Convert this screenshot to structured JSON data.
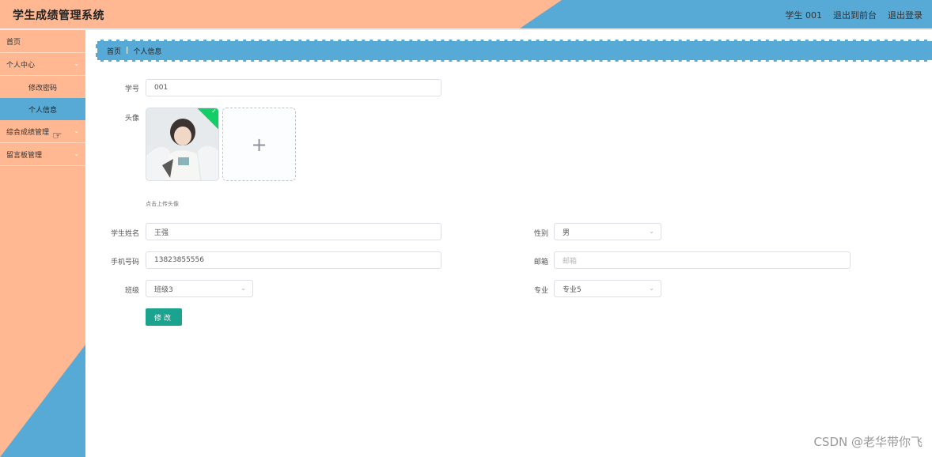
{
  "header": {
    "title": "学生成绩管理系统",
    "user": "学生 001",
    "front_link": "退出到前台",
    "logout_link": "退出登录"
  },
  "sidebar": {
    "items": [
      {
        "label": "首页"
      },
      {
        "label": "个人中心",
        "children": [
          {
            "label": "修改密码"
          },
          {
            "label": "个人信息",
            "active": true
          }
        ]
      },
      {
        "label": "综合成绩管理"
      },
      {
        "label": "留言板管理"
      }
    ]
  },
  "breadcrumb": {
    "home": "首页",
    "separator": "|",
    "current": "个人信息"
  },
  "form": {
    "student_id_label": "学号",
    "student_id_value": "001",
    "avatar_label": "头像",
    "upload_hint": "点击上传头像",
    "name_label": "学生姓名",
    "name_value": "王强",
    "gender_label": "性别",
    "gender_value": "男",
    "phone_label": "手机号码",
    "phone_value": "13823855556",
    "email_label": "邮箱",
    "email_placeholder": "邮箱",
    "class_label": "班级",
    "class_value": "班级3",
    "major_label": "专业",
    "major_value": "专业5",
    "submit_label": "修改"
  },
  "watermark": "CSDN @老华带你飞",
  "colors": {
    "peach": "#ffb892",
    "blue": "#57a9d6",
    "button": "#1aa38f",
    "success": "#13ce66"
  }
}
